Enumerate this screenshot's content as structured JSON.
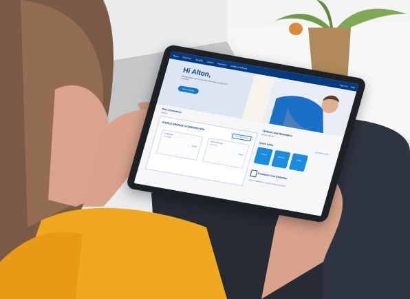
{
  "site": {
    "nav_items": [
      "Home",
      "Find Care",
      "Benefits",
      "Claims",
      "Pharmacy",
      "Health & Wellness"
    ],
    "nav_right": [
      "Sign Out",
      "Help"
    ]
  },
  "hero": {
    "greeting": "Hi Alton,",
    "copy": "Welcome back. Here is your plan information, updates and reminders.",
    "button": "Find a Doctor"
  },
  "content": {
    "section_title": "Plan Information",
    "subnote": "Medical",
    "plan_title": "CHOICE BRONZE STANDARD HSA",
    "plan_link": "View Plan Details",
    "deductibles": [
      {
        "label": "In-Network",
        "value": "Deductible",
        "badge": "Details"
      },
      {
        "label": "Out-of-Network",
        "value": "Deductible",
        "badge": "Details"
      }
    ]
  },
  "updates": {
    "title": "Updates and Reminders",
    "subtitle": "No new updates",
    "quick_title": "Quick Links",
    "quick_link": "View all quick links",
    "tiles": [
      "ID Card",
      "Find Care",
      "Claims"
    ],
    "cost_title": "Treatment Cost Estimator",
    "cost_sub": "Get cost estimates for common medical procedures."
  },
  "colors": {
    "nav": "#003a80",
    "accent": "#1a8ce0",
    "shirt": "#f0a91e"
  }
}
